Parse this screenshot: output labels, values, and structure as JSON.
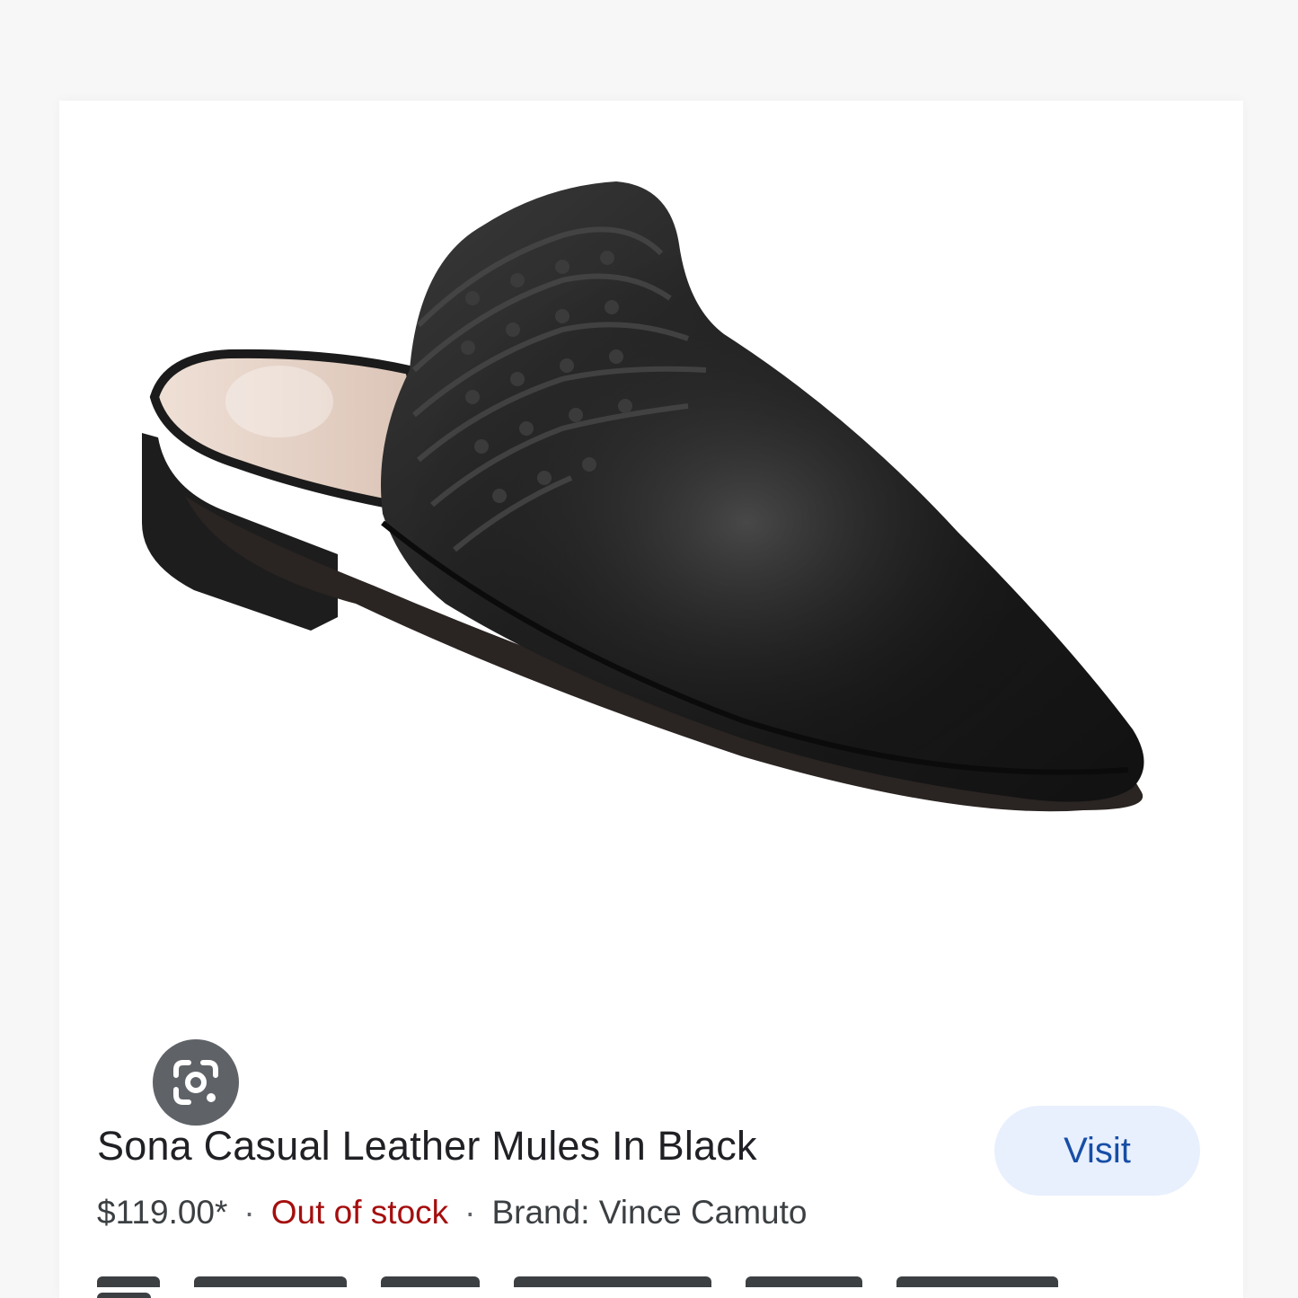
{
  "product": {
    "title": "Sona Casual Leather Mules In Black",
    "price": "$119.00*",
    "stock_status": "Out of stock",
    "brand": "Brand: Vince Camuto",
    "separator": "·"
  },
  "actions": {
    "visit_label": "Visit",
    "lens_icon": "google-lens-icon"
  },
  "image": {
    "subject": "shoe-image",
    "shoe_color": "#232323",
    "insole_color": "#e8d6cc"
  },
  "colors": {
    "visit_bg": "#e8f0fe",
    "visit_text": "#174ea6",
    "stock_text": "#a50e0e",
    "lens_bg": "#5f6368"
  }
}
